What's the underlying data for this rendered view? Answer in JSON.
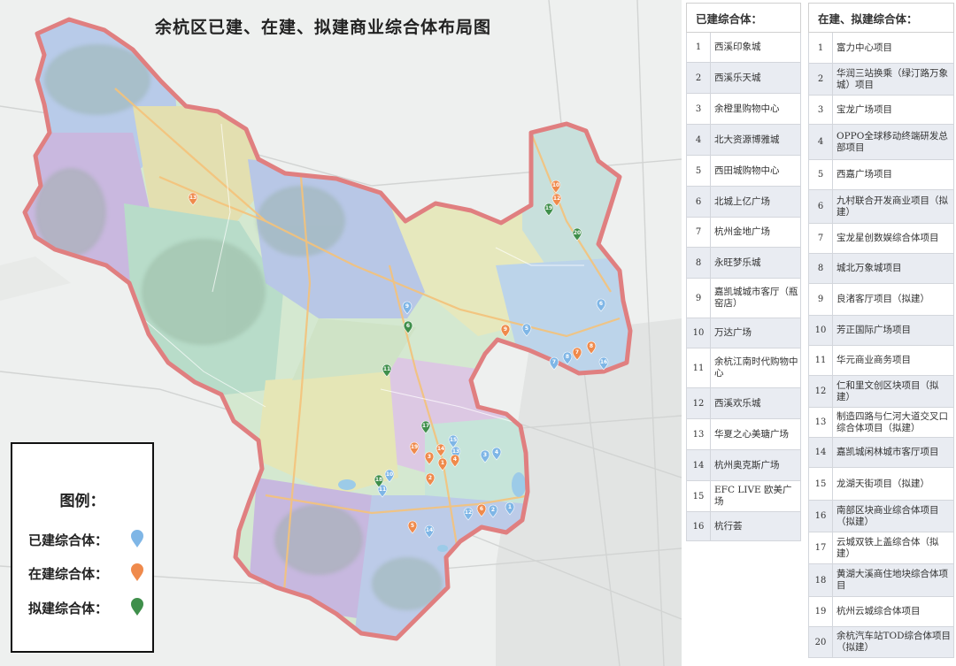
{
  "map": {
    "title": "余杭区已建、在建、拟建商业综合体布局图",
    "colors": {
      "built": "#7fb6e6",
      "under_construction": "#ef8a4c",
      "planned": "#3f8f4b",
      "boundary": "#e07f80"
    },
    "markers": [
      {
        "label": "13",
        "status": "under_construction"
      },
      {
        "label": "10",
        "status": "under_construction"
      },
      {
        "label": "12",
        "status": "under_construction"
      },
      {
        "label": "19",
        "status": "planned"
      },
      {
        "label": "20",
        "status": "planned"
      },
      {
        "label": "9",
        "status": "built"
      },
      {
        "label": "6",
        "status": "planned"
      },
      {
        "label": "11",
        "status": "planned"
      },
      {
        "label": "6",
        "status": "built"
      },
      {
        "label": "5",
        "status": "built"
      },
      {
        "label": "9",
        "status": "under_construction"
      },
      {
        "label": "8",
        "status": "under_construction"
      },
      {
        "label": "7",
        "status": "under_construction"
      },
      {
        "label": "8",
        "status": "built"
      },
      {
        "label": "7",
        "status": "built"
      },
      {
        "label": "16",
        "status": "built"
      },
      {
        "label": "17",
        "status": "planned"
      },
      {
        "label": "19",
        "status": "under_construction"
      },
      {
        "label": "14",
        "status": "under_construction"
      },
      {
        "label": "15",
        "status": "built"
      },
      {
        "label": "13",
        "status": "built"
      },
      {
        "label": "3",
        "status": "under_construction"
      },
      {
        "label": "1",
        "status": "under_construction"
      },
      {
        "label": "4",
        "status": "under_construction"
      },
      {
        "label": "2",
        "status": "under_construction"
      },
      {
        "label": "3",
        "status": "built"
      },
      {
        "label": "4",
        "status": "built"
      },
      {
        "label": "10",
        "status": "built"
      },
      {
        "label": "11",
        "status": "built"
      },
      {
        "label": "18",
        "status": "planned"
      },
      {
        "label": "12",
        "status": "built"
      },
      {
        "label": "6",
        "status": "under_construction"
      },
      {
        "label": "2",
        "status": "built"
      },
      {
        "label": "1",
        "status": "built"
      },
      {
        "label": "5",
        "status": "under_construction"
      },
      {
        "label": "14",
        "status": "built"
      }
    ]
  },
  "legend": {
    "title": "图例：",
    "built_label": "已建综合体：",
    "under_construction_label": "在建综合体：",
    "planned_label": "拟建综合体："
  },
  "built_table": {
    "header": "已建综合体：",
    "rows": [
      {
        "num": "1",
        "name": "西溪印象城"
      },
      {
        "num": "2",
        "name": "西溪乐天城"
      },
      {
        "num": "3",
        "name": "余橙里购物中心"
      },
      {
        "num": "4",
        "name": "北大资源博雅城"
      },
      {
        "num": "5",
        "name": "西田城购物中心"
      },
      {
        "num": "6",
        "name": "北城上亿广场"
      },
      {
        "num": "7",
        "name": "杭州金地广场"
      },
      {
        "num": "8",
        "name": "永旺梦乐城"
      },
      {
        "num": "9",
        "name": "嘉凯城城市客厅（瓶窑店）"
      },
      {
        "num": "10",
        "name": "万达广场"
      },
      {
        "num": "11",
        "name": "余杭江南时代购物中心"
      },
      {
        "num": "12",
        "name": "西溪欢乐城"
      },
      {
        "num": "13",
        "name": "华夏之心美瑭广场"
      },
      {
        "num": "14",
        "name": "杭州奥克斯广场"
      },
      {
        "num": "15",
        "name": "EFC LIVE 欧美广场"
      },
      {
        "num": "16",
        "name": "杭行荟"
      }
    ]
  },
  "plan_table": {
    "header": "在建、拟建综合体：",
    "rows": [
      {
        "num": "1",
        "name": "富力中心项目"
      },
      {
        "num": "2",
        "name": "华润三站换乘（绿汀路万象城）项目"
      },
      {
        "num": "3",
        "name": "宝龙广场项目"
      },
      {
        "num": "4",
        "name": "OPPO全球移动终端研发总部项目"
      },
      {
        "num": "5",
        "name": "西嘉广场项目"
      },
      {
        "num": "6",
        "name": "九村联合开发商业项目（拟建）"
      },
      {
        "num": "7",
        "name": "宝龙星创数娱综合体项目"
      },
      {
        "num": "8",
        "name": "城北万象城项目"
      },
      {
        "num": "9",
        "name": "良渚客厅项目（拟建）"
      },
      {
        "num": "10",
        "name": "芳正国际广场项目"
      },
      {
        "num": "11",
        "name": "华元商业商务项目"
      },
      {
        "num": "12",
        "name": "仁和里文创区块项目（拟建）"
      },
      {
        "num": "13",
        "name": "制造四路与仁河大道交叉口综合体项目（拟建）"
      },
      {
        "num": "14",
        "name": "嘉凯城闲林城市客厅项目"
      },
      {
        "num": "15",
        "name": "龙湖天街项目（拟建）"
      },
      {
        "num": "16",
        "name": "南部区块商业综合体项目（拟建）"
      },
      {
        "num": "17",
        "name": "云城双铁上盖综合体（拟建）"
      },
      {
        "num": "18",
        "name": "黄湖大溪商住地块综合体项目"
      },
      {
        "num": "19",
        "name": "杭州云城综合体项目"
      },
      {
        "num": "20",
        "name": "余杭汽车站TOD综合体项目（拟建）"
      }
    ]
  }
}
